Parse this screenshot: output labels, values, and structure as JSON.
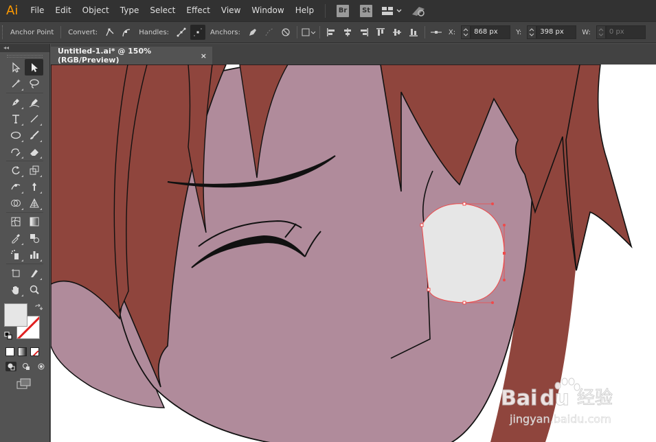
{
  "app": {
    "logo": "Ai",
    "brand_color": "#ff9a00"
  },
  "menu": {
    "items": [
      {
        "id": "file",
        "label": "File"
      },
      {
        "id": "edit",
        "label": "Edit"
      },
      {
        "id": "object",
        "label": "Object"
      },
      {
        "id": "type",
        "label": "Type"
      },
      {
        "id": "select",
        "label": "Select"
      },
      {
        "id": "effect",
        "label": "Effect"
      },
      {
        "id": "view",
        "label": "View"
      },
      {
        "id": "window",
        "label": "Window"
      },
      {
        "id": "help",
        "label": "Help"
      }
    ],
    "bridge_label": "Br",
    "stock_label": "St"
  },
  "control": {
    "tool_name": "Anchor Point",
    "convert_label": "Convert:",
    "handles_label": "Handles:",
    "anchors_label": "Anchors:",
    "x_label": "X:",
    "x_value": "868 px",
    "y_label": "Y:",
    "y_value": "398 px",
    "w_label": "W:",
    "w_value": "0 px"
  },
  "toolbox": {
    "collapse_label": "◂◂"
  },
  "document": {
    "tab_title": "Untitled-1.ai* @ 150% (RGB/Preview)",
    "close_label": "×"
  },
  "colors": {
    "hair": "#8f453d",
    "skin": "#b08b9b",
    "selected_shape": "#e6e6e6",
    "selection": "#ef4a4a",
    "ui_dark": "#323232",
    "ui_mid": "#424242",
    "ui_panel": "#535353"
  },
  "watermark": {
    "brand": "Bai",
    "brand_suffix": "du",
    "cn": "经验",
    "url": "jingyan.baidu.com"
  }
}
